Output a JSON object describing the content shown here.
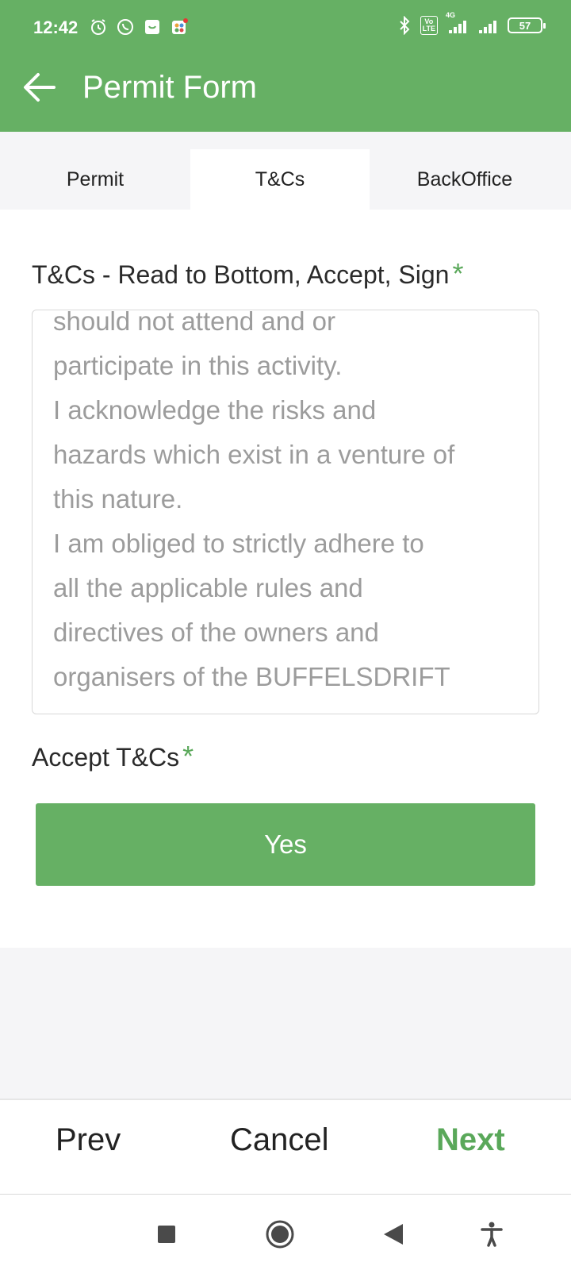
{
  "status_bar": {
    "time": "12:42",
    "network": "4G",
    "volte": "Vo\nLTE",
    "battery": "57",
    "icons": [
      "alarm-icon",
      "whatsapp-icon",
      "shopping-bag-icon",
      "app-icon",
      "bluetooth-icon",
      "signal-icon"
    ]
  },
  "app_bar": {
    "title": "Permit Form",
    "back_icon": "arrow-left-icon"
  },
  "tabs": [
    {
      "label": "Permit",
      "active": false
    },
    {
      "label": "T&Cs",
      "active": true
    },
    {
      "label": "BackOffice",
      "active": false
    }
  ],
  "form": {
    "tcs_label": "T&Cs - Read to Bottom, Accept, Sign",
    "required_mark": "*",
    "tcs_text": "should not attend and or\nparticipate in this activity.\nI acknowledge the risks and\nhazards which exist in a venture of\nthis nature.\nI am obliged to strictly adhere to\nall the applicable rules and\ndirectives of the owners and\norganisers of the BUFFELSDRIFT",
    "accept_label": "Accept T&Cs",
    "accept_value": "Yes"
  },
  "bottom_actions": {
    "prev": "Prev",
    "cancel": "Cancel",
    "next": "Next"
  },
  "system_nav": [
    "recents-icon",
    "home-icon",
    "back-icon",
    "accessibility-icon"
  ],
  "colors": {
    "primary": "#66b064",
    "required": "#5aa85a",
    "terms_text": "#9c9c9c",
    "background": "#f5f5f7"
  }
}
